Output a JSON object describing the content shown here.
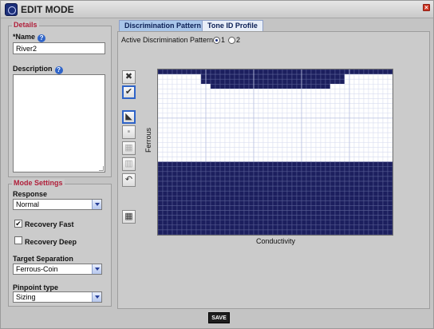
{
  "window": {
    "title": "EDIT MODE"
  },
  "details": {
    "legend": "Details",
    "name_label": "*Name",
    "name_value": "River2",
    "description_label": "Description",
    "description_value": ""
  },
  "mode_settings": {
    "legend": "Mode Settings",
    "response_label": "Response",
    "response_value": "Normal",
    "recovery_fast_label": "Recovery Fast",
    "recovery_fast_checked": true,
    "recovery_deep_label": "Recovery Deep",
    "recovery_deep_checked": false,
    "target_separation_label": "Target Separation",
    "target_separation_value": "Ferrous-Coin",
    "pinpoint_label": "Pinpoint type",
    "pinpoint_value": "Sizing"
  },
  "tabs": [
    {
      "label": "Discrimination Pattern",
      "active": true
    },
    {
      "label": "Tone ID Profile",
      "active": false
    }
  ],
  "pattern": {
    "active_label": "Active Discrimination Pattern:",
    "options": [
      "1",
      "2"
    ],
    "selected": "1",
    "y_axis_label": "Ferrous",
    "x_axis_label": "Conductivity",
    "grid_columns": 49,
    "grid_rows": 34,
    "accepted_color": "#ffffff",
    "rejected_color": "#1c1f5e",
    "rejected_top_segments": [
      {
        "col_start": 0,
        "col_end": 48,
        "row_end": 0
      },
      {
        "col_start": 9,
        "col_end": 38,
        "row_end": 2
      },
      {
        "col_start": 11,
        "col_end": 35,
        "row_end": 3
      }
    ],
    "rejected_bottom_row_start": 19
  },
  "tools": [
    {
      "name": "reject-all-button",
      "glyph": "✖"
    },
    {
      "name": "accept-all-button",
      "glyph": "✔"
    },
    {
      "name": "pointer-tool-button",
      "glyph": "▣"
    },
    {
      "name": "single-cell-tool-button",
      "glyph": "▪"
    },
    {
      "name": "block-tool-button",
      "glyph": "▦"
    },
    {
      "name": "column-tool-button",
      "glyph": "▥"
    },
    {
      "name": "undo-button",
      "glyph": "↶"
    },
    {
      "name": "grid-toggle-button",
      "glyph": "▦"
    }
  ],
  "footer": {
    "save_label": "SAVE"
  },
  "colors": {
    "accent": "#1c2f7a",
    "legend": "#b0203b",
    "tab_active": "#a9c6ea"
  }
}
